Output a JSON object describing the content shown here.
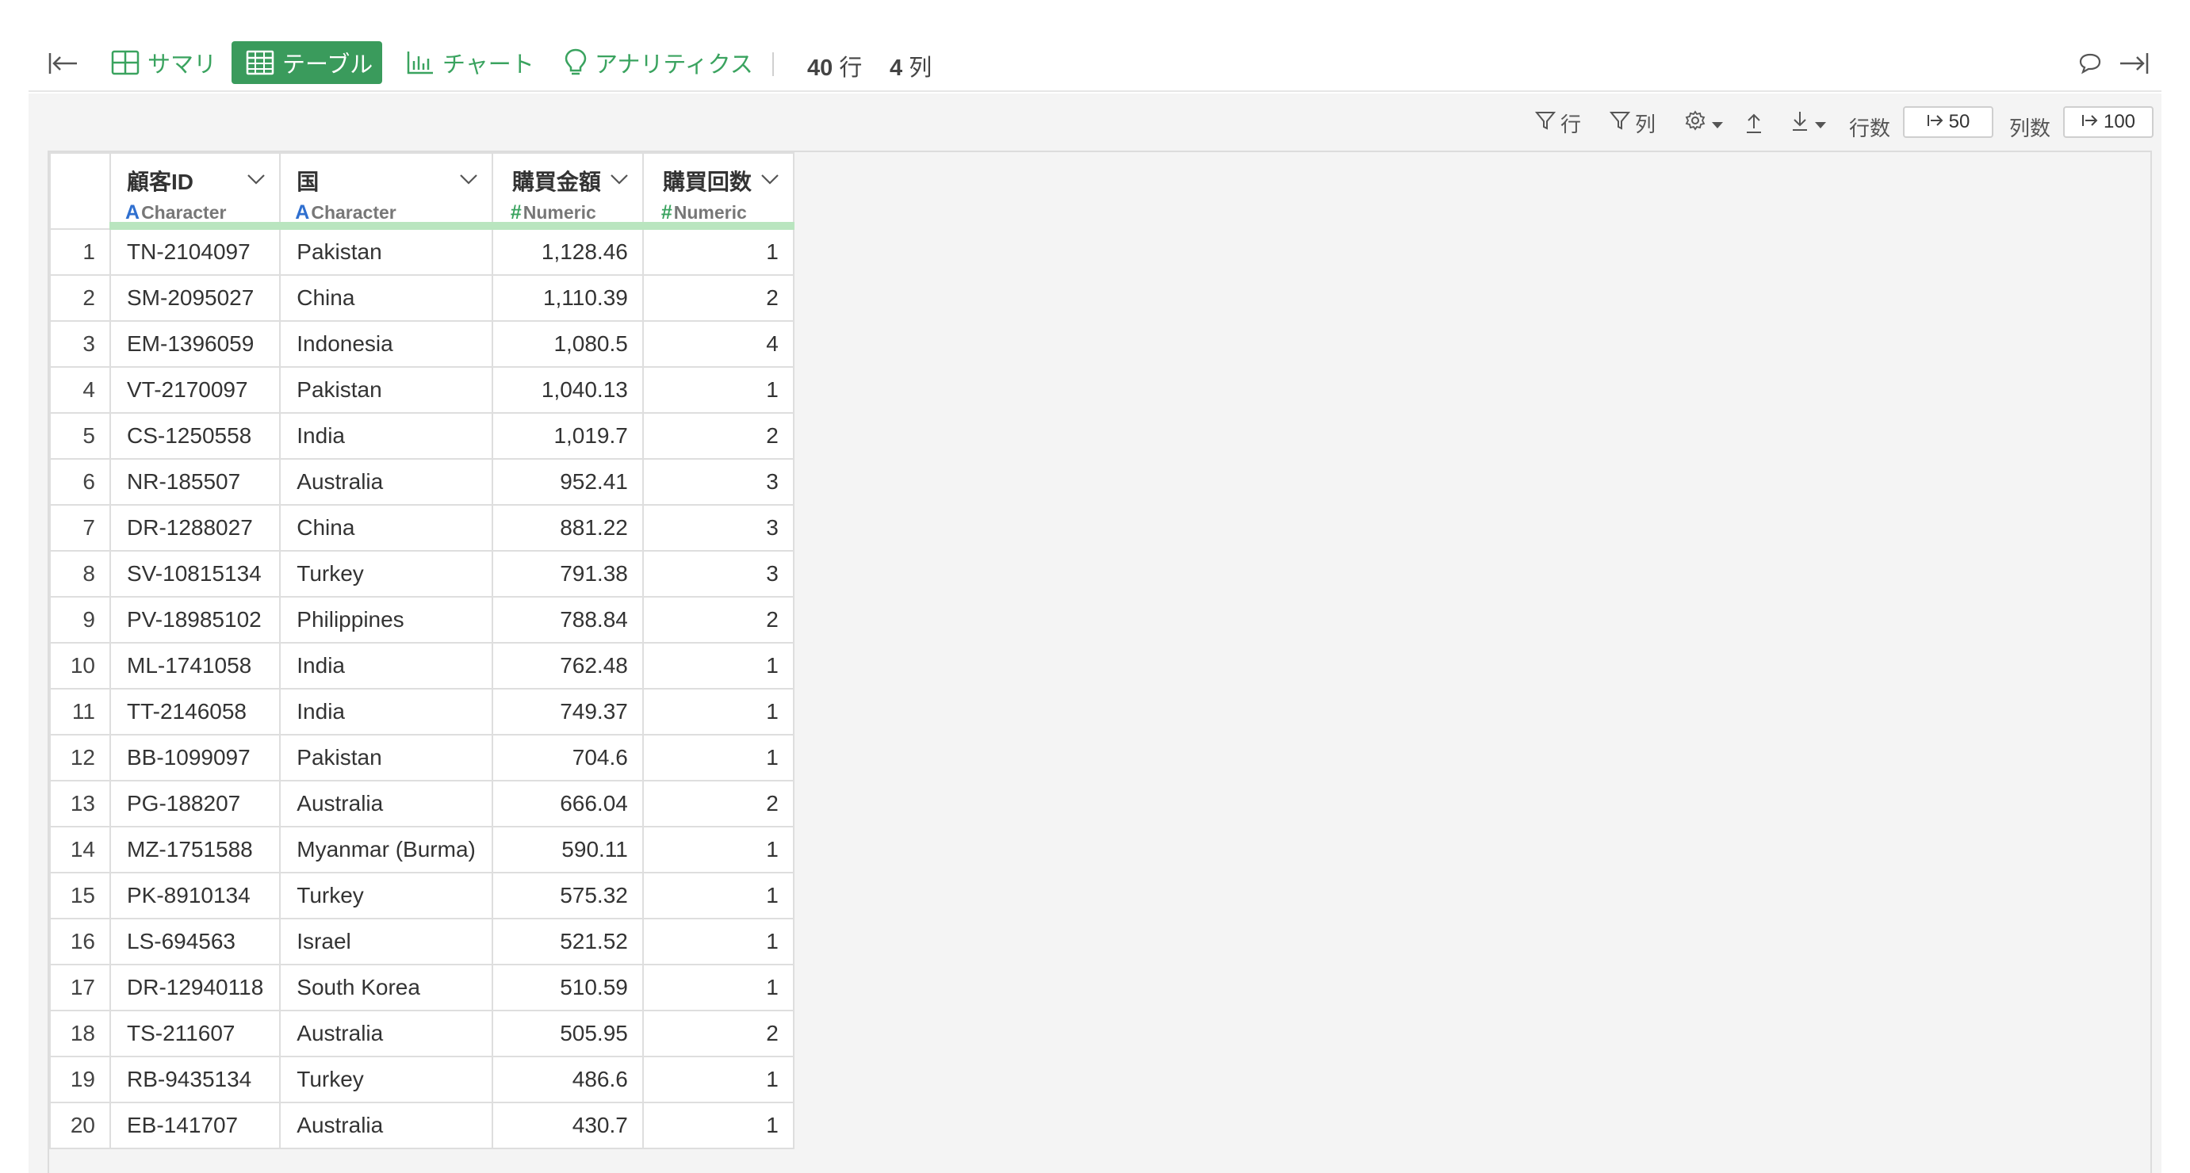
{
  "toolbar": {
    "tabs": [
      {
        "label": "サマリ",
        "icon": "summary-grid-icon",
        "active": false
      },
      {
        "label": "テーブル",
        "icon": "table-icon",
        "active": true
      },
      {
        "label": "チャート",
        "icon": "bar-chart-icon",
        "active": false
      },
      {
        "label": "アナリティクス",
        "icon": "lightbulb-icon",
        "active": false
      }
    ],
    "row_count": "40",
    "row_unit": "行",
    "col_count": "4",
    "col_unit": "列"
  },
  "subbar": {
    "filter_row_label": "行",
    "filter_col_label": "列",
    "rows_label": "行数",
    "rows_value": "50",
    "cols_label": "列数",
    "cols_value": "100"
  },
  "colors": {
    "accent": "#3a9b5c",
    "type_character": "#2f6fcf",
    "type_numeric": "#3aa35f",
    "header_bar": "#b9e5bf"
  },
  "table": {
    "columns": [
      {
        "name": "顧客ID",
        "type_symbol": "A",
        "type": "Character"
      },
      {
        "name": "国",
        "type_symbol": "A",
        "type": "Character"
      },
      {
        "name": "購買金額",
        "type_symbol": "#",
        "type": "Numeric"
      },
      {
        "name": "購買回数",
        "type_symbol": "#",
        "type": "Numeric"
      }
    ],
    "rows": [
      [
        "1",
        "TN-2104097",
        "Pakistan",
        "1,128.46",
        "1"
      ],
      [
        "2",
        "SM-2095027",
        "China",
        "1,110.39",
        "2"
      ],
      [
        "3",
        "EM-1396059",
        "Indonesia",
        "1,080.5",
        "4"
      ],
      [
        "4",
        "VT-2170097",
        "Pakistan",
        "1,040.13",
        "1"
      ],
      [
        "5",
        "CS-1250558",
        "India",
        "1,019.7",
        "2"
      ],
      [
        "6",
        "NR-185507",
        "Australia",
        "952.41",
        "3"
      ],
      [
        "7",
        "DR-1288027",
        "China",
        "881.22",
        "3"
      ],
      [
        "8",
        "SV-10815134",
        "Turkey",
        "791.38",
        "3"
      ],
      [
        "9",
        "PV-18985102",
        "Philippines",
        "788.84",
        "2"
      ],
      [
        "10",
        "ML-1741058",
        "India",
        "762.48",
        "1"
      ],
      [
        "11",
        "TT-2146058",
        "India",
        "749.37",
        "1"
      ],
      [
        "12",
        "BB-1099097",
        "Pakistan",
        "704.6",
        "1"
      ],
      [
        "13",
        "PG-188207",
        "Australia",
        "666.04",
        "2"
      ],
      [
        "14",
        "MZ-1751588",
        "Myanmar (Burma)",
        "590.11",
        "1"
      ],
      [
        "15",
        "PK-8910134",
        "Turkey",
        "575.32",
        "1"
      ],
      [
        "16",
        "LS-694563",
        "Israel",
        "521.52",
        "1"
      ],
      [
        "17",
        "DR-12940118",
        "South Korea",
        "510.59",
        "1"
      ],
      [
        "18",
        "TS-211607",
        "Australia",
        "505.95",
        "2"
      ],
      [
        "19",
        "RB-9435134",
        "Turkey",
        "486.6",
        "1"
      ],
      [
        "20",
        "EB-141707",
        "Australia",
        "430.7",
        "1"
      ]
    ]
  }
}
